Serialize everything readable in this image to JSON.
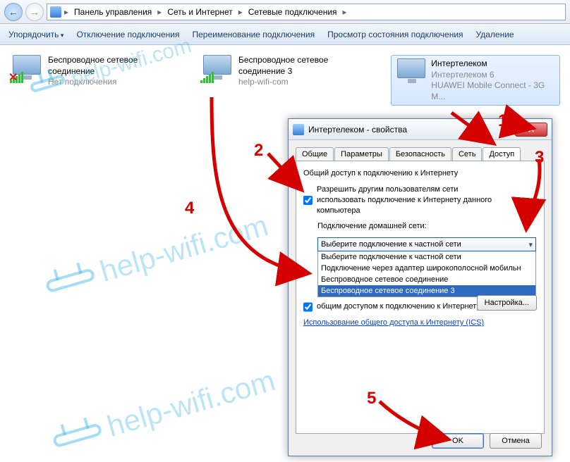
{
  "breadcrumb": {
    "items": [
      "Панель управления",
      "Сеть и Интернет",
      "Сетевые подключения"
    ]
  },
  "toolbar": {
    "organize": "Упорядочить",
    "disable": "Отключение подключения",
    "rename": "Переименование подключения",
    "view_status": "Просмотр состояния подключения",
    "delete": "Удаление"
  },
  "connections": [
    {
      "line1": "Беспроводное сетевое",
      "line2": "соединение",
      "line3": "Нет подключения",
      "disconnected": true
    },
    {
      "line1": "Беспроводное сетевое",
      "line2": "соединение 3",
      "line3": "help-wifi-com",
      "disconnected": false
    },
    {
      "line1": "Интертелеком",
      "line2": "Интертелеком 6",
      "line3": "HUAWEI Mobile Connect - 3G M...",
      "disconnected": false,
      "selected": true
    }
  ],
  "dialog": {
    "title": "Интертелеком - свойства",
    "tabs": [
      "Общие",
      "Параметры",
      "Безопасность",
      "Сеть",
      "Доступ"
    ],
    "active_tab": 4,
    "heading": "Общий доступ к подключению к Интернету",
    "allow_label_l1": "Разрешить другим пользователям сети",
    "allow_label_l2": "использовать подключение к Интернету данного",
    "allow_label_l3": "компьютера",
    "homenet_label": "Подключение домашней сети:",
    "combo_value": "Выберите подключение к частной сети",
    "options": [
      "Выберите подключение к частной сети",
      "Подключение через адаптер широкополосной мобильн",
      "Беспроводное сетевое соединение",
      "Беспроводное сетевое соединение 3"
    ],
    "selected_option": 3,
    "manage_label": "общим доступом к подключению к Интернету",
    "link_label": "Использование общего доступа к Интернету (ICS)",
    "settings_btn": "Настройка...",
    "ok": "OK",
    "cancel": "Отмена"
  },
  "annotations": {
    "n1": "1",
    "n2": "2",
    "n3": "3",
    "n4": "4",
    "n5": "5"
  },
  "watermark": "help-wifi.com"
}
